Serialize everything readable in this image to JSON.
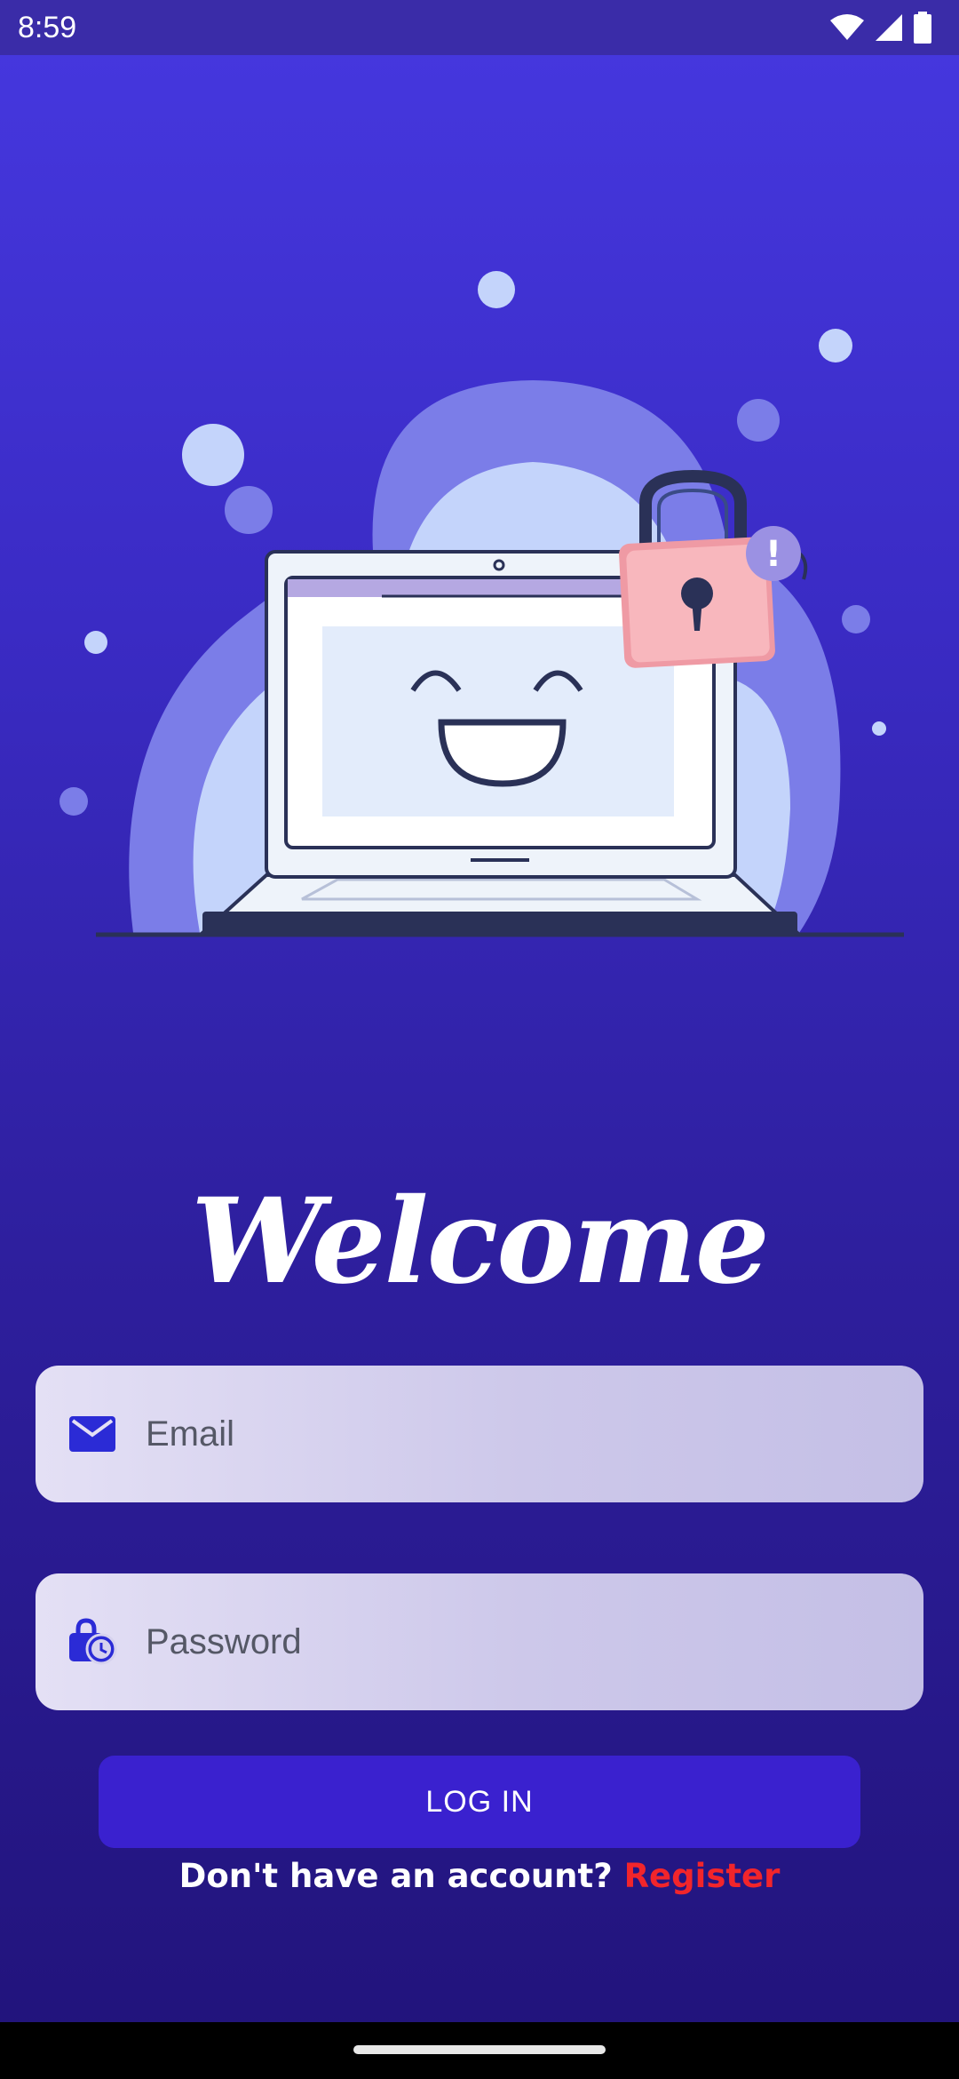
{
  "status_bar": {
    "time": "8:59",
    "icons": [
      "wifi-icon",
      "cellular-signal-icon",
      "battery-icon"
    ]
  },
  "illustration": {
    "name": "laptop-with-padlock-illustration",
    "lock_alert_text": "!"
  },
  "welcome": {
    "title": "Welcome"
  },
  "form": {
    "email": {
      "placeholder": "Email",
      "value": "",
      "icon": "mail-icon"
    },
    "password": {
      "placeholder": "Password",
      "value": "",
      "icon": "lock-clock-icon"
    },
    "login_label": "LOG IN"
  },
  "register": {
    "prompt": "Don't have an account? ",
    "link_label": "Register"
  },
  "colors": {
    "background_top": "#4638e0",
    "background_bottom": "#21137a",
    "button": "#3a21cf",
    "register_link": "#f2252b",
    "icon": "#2b2bd6"
  }
}
